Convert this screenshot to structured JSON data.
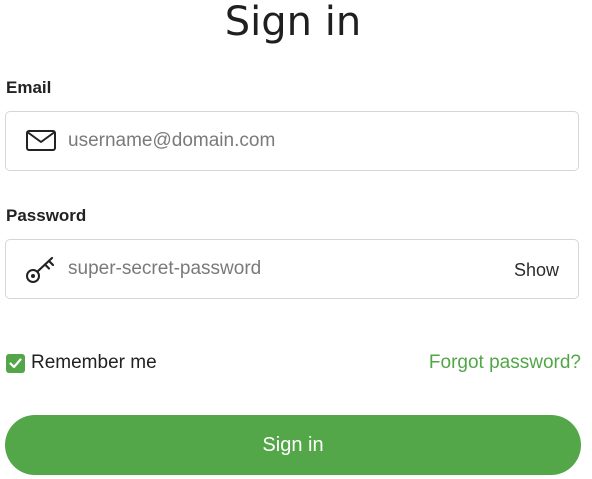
{
  "page": {
    "title": "Sign in"
  },
  "email": {
    "label": "Email",
    "icon": "mail-icon",
    "value": "",
    "placeholder": "username@domain.com"
  },
  "password": {
    "label": "Password",
    "icon": "key-icon",
    "value": "",
    "placeholder": "super-secret-password",
    "show_label": "Show"
  },
  "remember": {
    "label": "Remember me",
    "checked": true
  },
  "forgot": {
    "label": "Forgot password?"
  },
  "submit": {
    "label": "Sign in"
  },
  "colors": {
    "accent": "#53a748",
    "border": "#d6d6d6",
    "text": "#222222"
  }
}
